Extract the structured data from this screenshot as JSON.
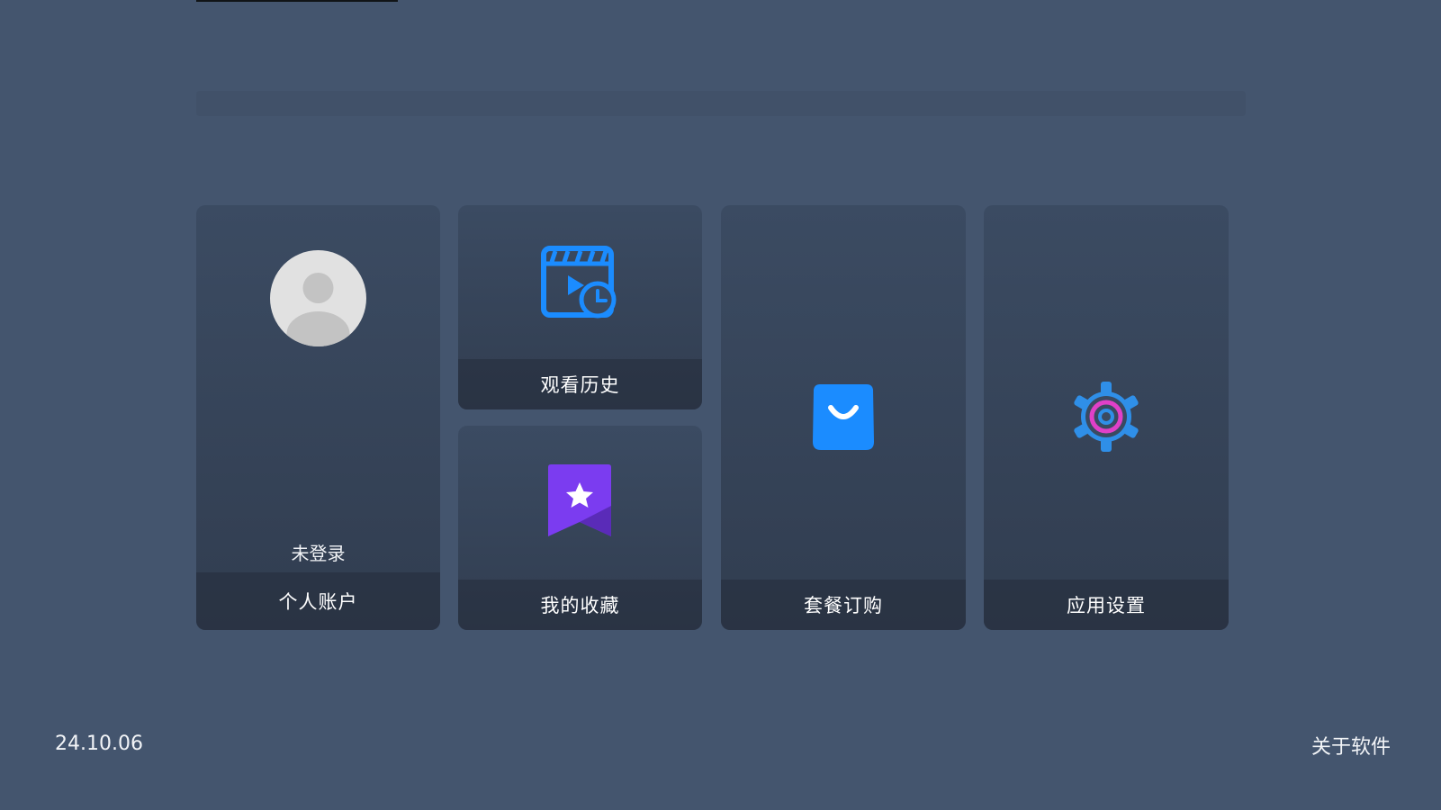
{
  "tiles": {
    "account": {
      "label": "个人账户",
      "status": "未登录",
      "icon": "avatar-placeholder-icon"
    },
    "history": {
      "label": "观看历史",
      "icon": "video-history-icon"
    },
    "favorites": {
      "label": "我的收藏",
      "icon": "bookmark-star-icon"
    },
    "plans": {
      "label": "套餐订购",
      "icon": "shopping-bag-icon"
    },
    "settings": {
      "label": "应用设置",
      "icon": "gear-icon"
    }
  },
  "footer": {
    "version": "24.10.06",
    "about": "关于软件"
  },
  "colors": {
    "background": "#44556e",
    "tile_top": "#3b4b62",
    "tile_bottom": "#313d50",
    "accent_blue": "#1b8cff",
    "accent_purple": "#7b3cf0",
    "accent_magenta": "#e040c8"
  }
}
